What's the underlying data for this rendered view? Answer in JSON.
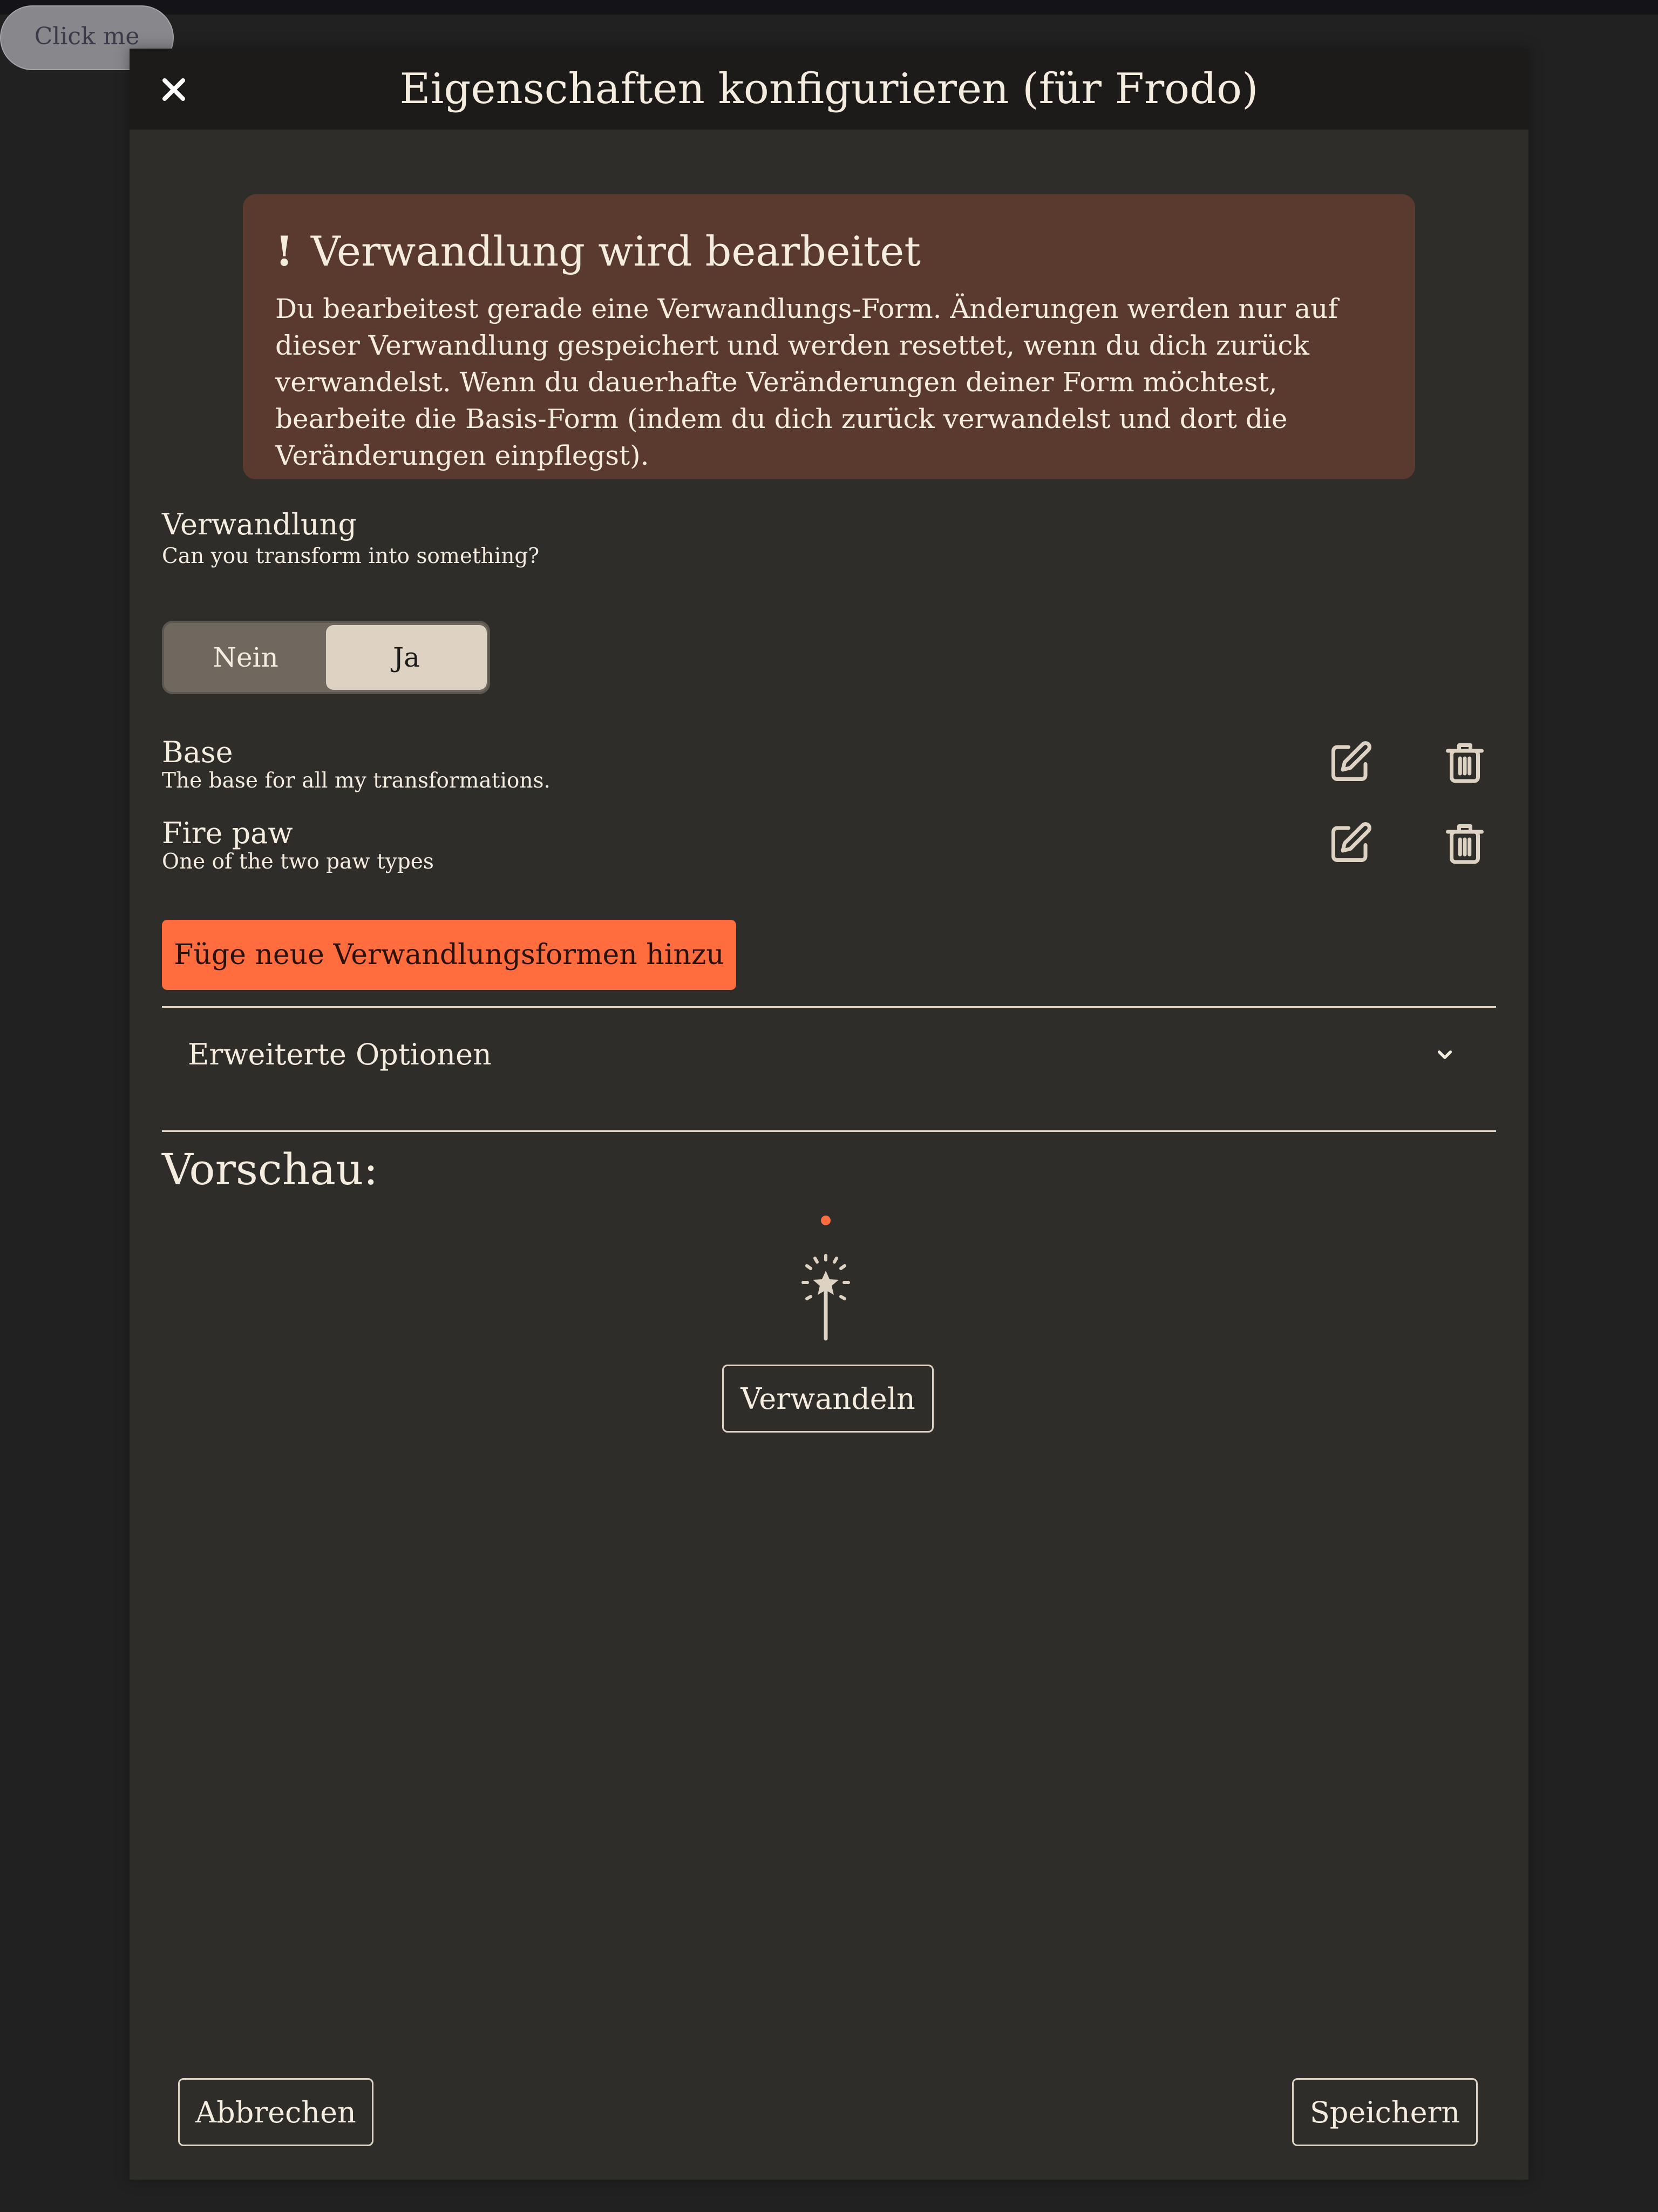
{
  "background_button": {
    "label": "Click me"
  },
  "modal": {
    "title": "Eigenschaften konfigurieren (für Frodo)",
    "close_icon": "close-icon",
    "warning": {
      "icon": "!",
      "title": "Verwandlung wird bearbeitet",
      "text": "Du bearbeitest gerade eine Verwandlungs-Form. Änderungen werden nur auf dieser Verwandlung gespeichert und werden resettet, wenn du dich zurück verwandelst. Wenn du dauerhafte Veränderungen deiner Form möchtest, bearbeite die Basis-Form (indem du dich zurück verwandelst und dort die Veränderungen einpflegst)."
    },
    "transformation": {
      "label": "Verwandlung",
      "sublabel": "Can you transform into something?",
      "options": [
        "Nein",
        "Ja"
      ],
      "selected": "Ja"
    },
    "forms": [
      {
        "name": "Base",
        "description": "The base for all my transformations."
      },
      {
        "name": "Fire paw",
        "description": "One of the two paw types"
      }
    ],
    "add_button": "Füge neue Verwandlungsformen hinzu",
    "advanced": {
      "label": "Erweiterte Optionen",
      "expanded": false
    },
    "preview": {
      "title": "Vorschau:",
      "icon": "magic-wand-icon",
      "button": "Verwandeln"
    },
    "footer": {
      "cancel": "Abbrechen",
      "save": "Speichern"
    }
  },
  "colors": {
    "page_bg": "#222121",
    "modal_bg": "#2e2d2a",
    "header_bg": "#1c1b19",
    "warning_bg": "#5a3a2e",
    "accent": "#ff6c3d",
    "text": "#f5ece0",
    "toggle_selected": "#ded2c2"
  }
}
